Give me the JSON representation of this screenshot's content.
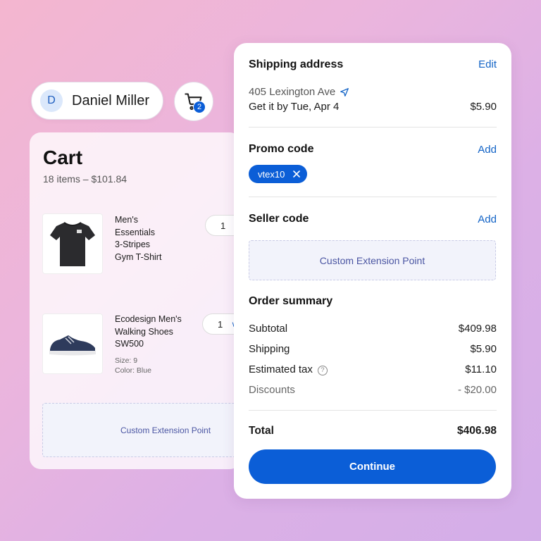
{
  "user": {
    "initial": "D",
    "name": "Daniel Miller"
  },
  "cart_button": {
    "badge": "2",
    "icon": "cart-icon"
  },
  "cart": {
    "title": "Cart",
    "summary": "18 items – $101.84",
    "items": [
      {
        "name": "Men's Essentials 3-Stripes Gym T-Shirt",
        "name_lines": [
          "Men's",
          "Essentials",
          "3-Stripes",
          "Gym T-Shirt"
        ],
        "qty": "1"
      },
      {
        "name": "Ecodesign Men's Walking Shoes SW500",
        "name_lines": [
          "Ecodesign Men's",
          "Walking Shoes",
          "SW500"
        ],
        "size": "Size: 9",
        "color": "Color: Blue",
        "qty": "1"
      }
    ],
    "extension_point": "Custom Extension Point"
  },
  "shipping": {
    "title": "Shipping address",
    "edit_label": "Edit",
    "address": "405 Lexington Ave",
    "delivery": "Get it by Tue, Apr 4",
    "price": "$5.90"
  },
  "promo": {
    "title": "Promo code",
    "add_label": "Add",
    "code": "vtex10"
  },
  "seller": {
    "title": "Seller code",
    "add_label": "Add",
    "extension_point": "Custom Extension Point"
  },
  "summary": {
    "title": "Order summary",
    "subtotal_label": "Subtotal",
    "subtotal": "$409.98",
    "shipping_label": "Shipping",
    "shipping": "$5.90",
    "tax_label": "Estimated tax",
    "tax": "$11.10",
    "discounts_label": "Discounts",
    "discounts": "- $20.00",
    "total_label": "Total",
    "total": "$406.98"
  },
  "continue_label": "Continue",
  "colors": {
    "accent": "#0b5ed7",
    "link": "#1263c6"
  }
}
